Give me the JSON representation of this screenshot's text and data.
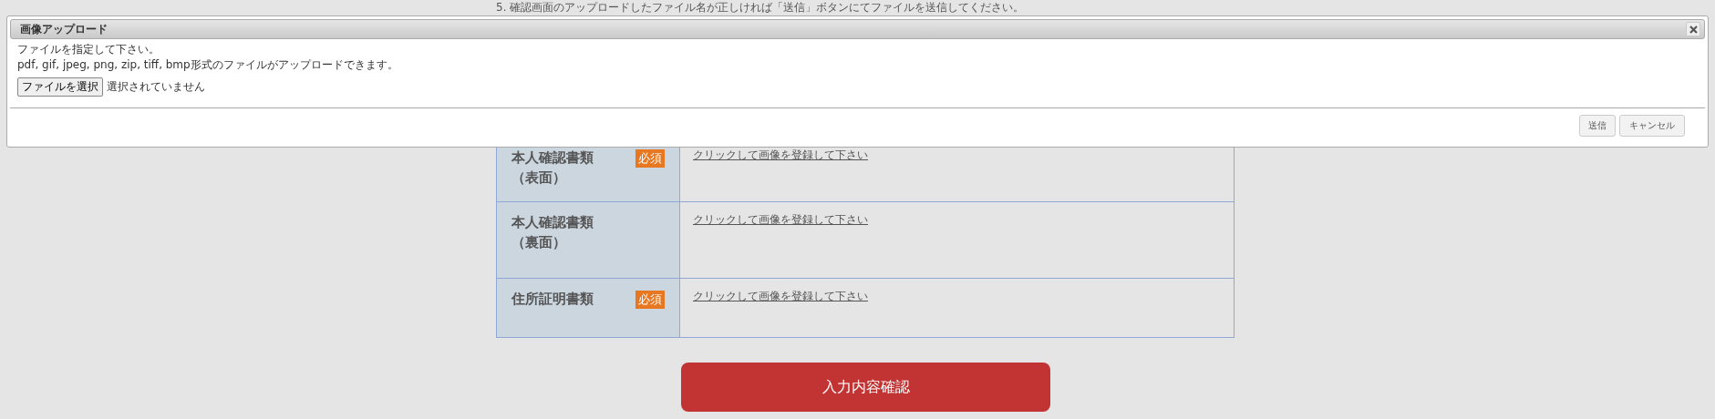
{
  "instruction": "5. 確認画面のアップロードしたファイル名が正しければ「送信」ボタンにてファイルを送信してください。",
  "dialog": {
    "title": "画像アップロード",
    "prompt": "ファイルを指定して下さい。",
    "formats_note": "pdf, gif, jpeg, png, zip, tiff, bmp形式のファイルがアップロードできます。",
    "file_button": "ファイルを選択",
    "file_status": "選択されていません",
    "buttons": [
      "送信",
      "キャンセル"
    ]
  },
  "upload_rows": [
    {
      "label_lines": [
        "本人確認書類",
        "（表面）"
      ],
      "required": true,
      "badge": "必須",
      "link": "クリックして画像を登録して下さい"
    },
    {
      "label_lines": [
        "本人確認書類",
        "（裏面）"
      ],
      "required": false,
      "link": "クリックして画像を登録して下さい"
    },
    {
      "label_lines": [
        "住所証明書類"
      ],
      "required": true,
      "badge": "必須",
      "link": "クリックして画像を登録して下さい"
    }
  ],
  "confirm_button": "入力内容確認"
}
